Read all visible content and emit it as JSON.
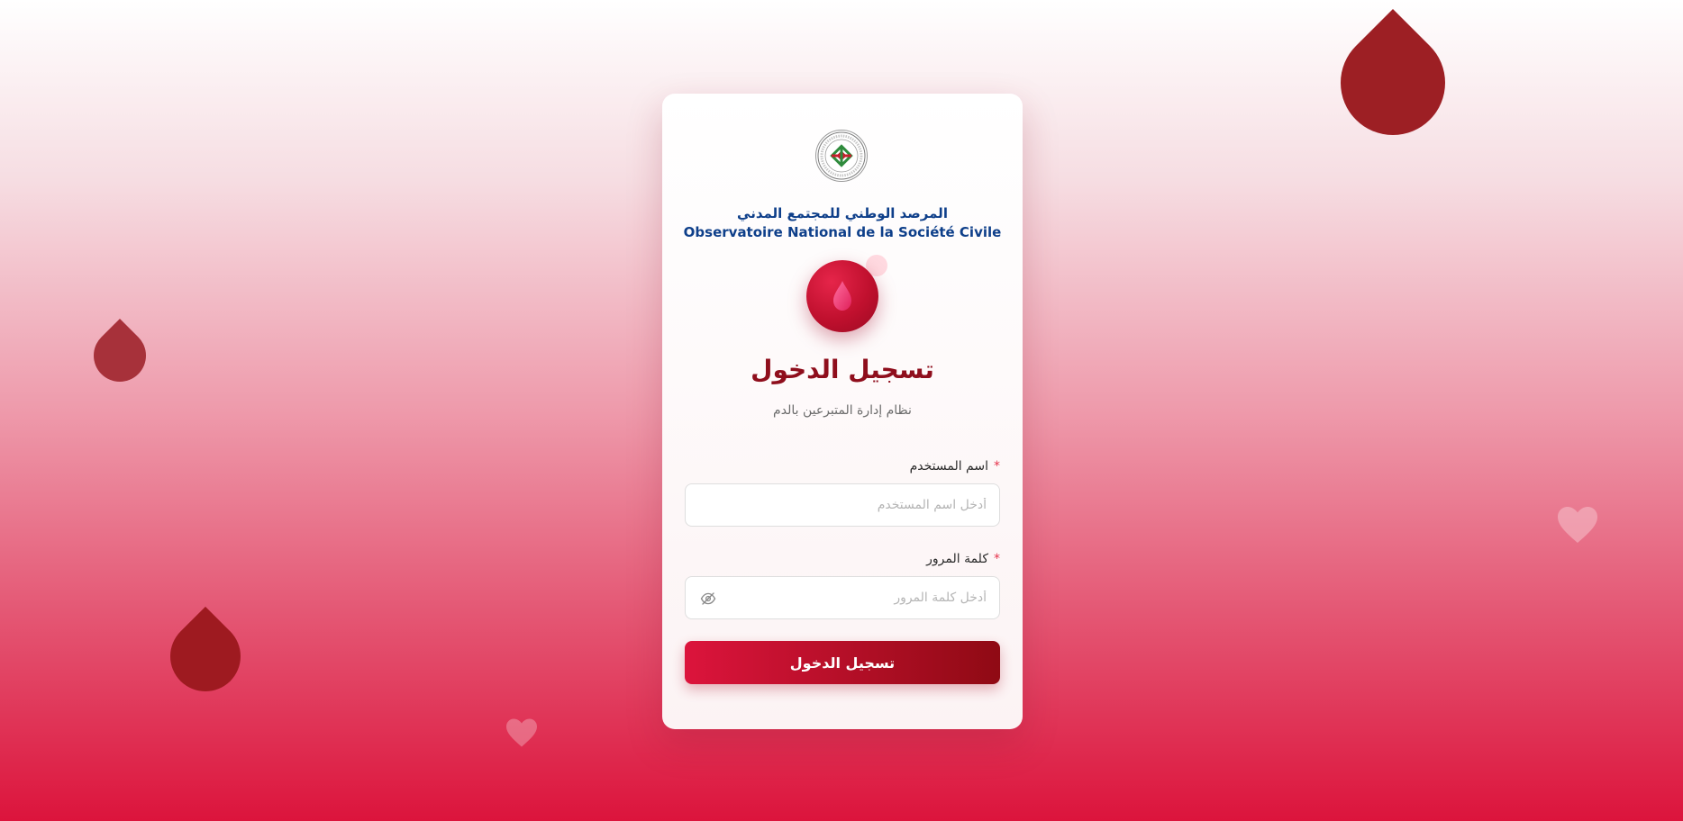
{
  "organization": {
    "name_ar": "المرصد الوطني للمجتمع المدني",
    "name_fr": "Observatoire National de la Société Civile"
  },
  "login": {
    "title": "تسجيل الدخول",
    "subtitle": "نظام إدارة المتبرعين بالدم",
    "username": {
      "label": "اسم المستخدم",
      "placeholder": "أدخل اسم المستخدم",
      "value": "",
      "required_marker": "*"
    },
    "password": {
      "label": "كلمة المرور",
      "placeholder": "أدخل كلمة المرور",
      "value": "",
      "required_marker": "*",
      "toggle_icon": "eye-off-icon"
    },
    "submit_label": "تسجيل الدخول"
  },
  "colors": {
    "brand_red": "#dc143c",
    "dark_red": "#8f0e1c",
    "org_blue": "#0e3f8a",
    "required_star": "#e5334b"
  },
  "icons": {
    "logo": "organization-seal-icon",
    "badge": "blood-drop-icon",
    "decorations": [
      "blood-drop-icon",
      "heart-icon"
    ]
  }
}
